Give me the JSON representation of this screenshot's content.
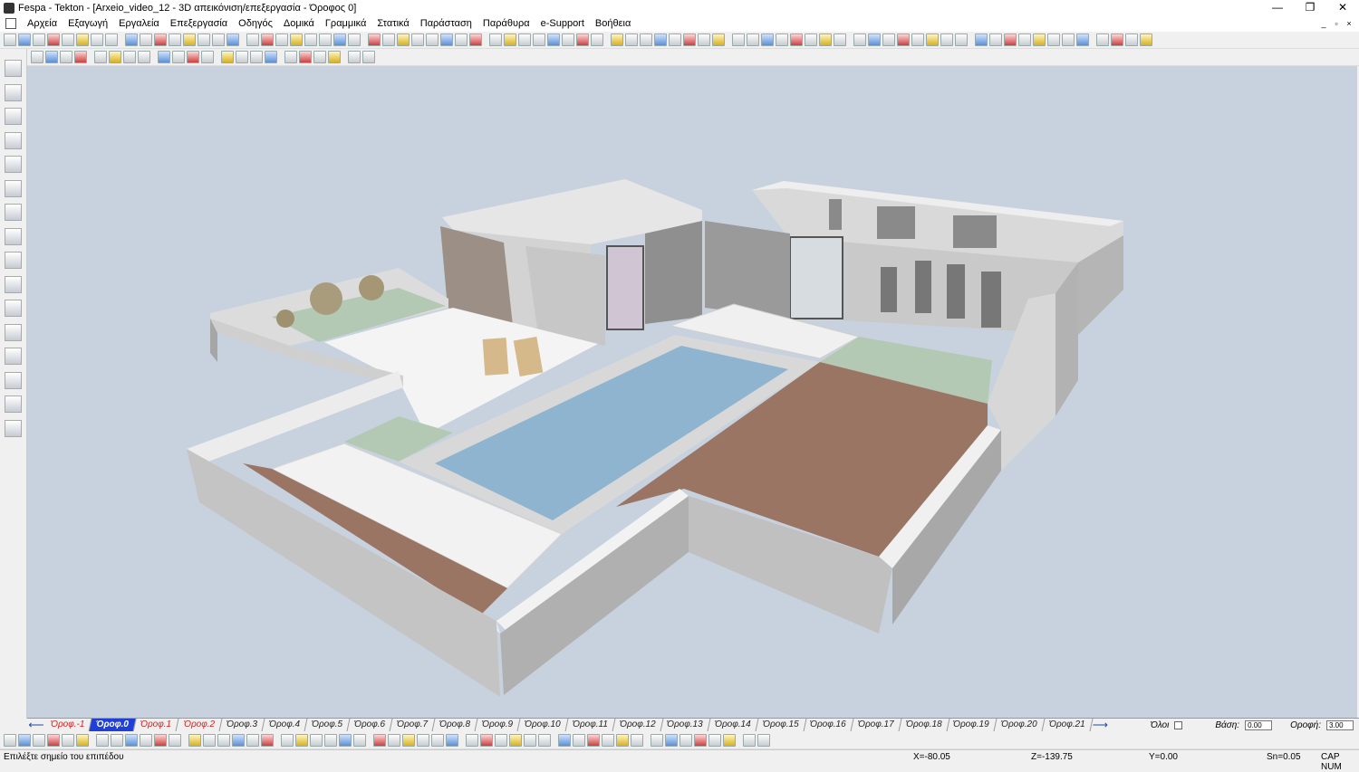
{
  "window": {
    "title": "Fespa - Tekton - [Arxeio_video_12 - 3D απεικόνιση/επεξεργασία - Όροφος 0]",
    "minimize_glyph": "—",
    "restore_glyph": "❐",
    "close_glyph": "✕"
  },
  "menu": [
    "Αρχεία",
    "Εξαγωγή",
    "Εργαλεία",
    "Επεξεργασία",
    "Οδηγός",
    "Δομικά",
    "Γραμμικά",
    "Στατικά",
    "Παράσταση",
    "Παράθυρα",
    "e-Support",
    "Βοήθεια"
  ],
  "mdi_buttons": [
    "_",
    "▫",
    "×"
  ],
  "floors": {
    "left_arrow": "⟵",
    "right_arrow": "⟶",
    "tabs": [
      {
        "label": "Όροφ.-1",
        "style": "red"
      },
      {
        "label": "Όροφ.0",
        "style": "active"
      },
      {
        "label": "Όροφ.1",
        "style": "red"
      },
      {
        "label": "Όροφ.2",
        "style": "red"
      },
      {
        "label": "Όροφ.3",
        "style": "normal"
      },
      {
        "label": "Όροφ.4",
        "style": "normal"
      },
      {
        "label": "Όροφ.5",
        "style": "normal"
      },
      {
        "label": "Όροφ.6",
        "style": "normal"
      },
      {
        "label": "Όροφ.7",
        "style": "normal"
      },
      {
        "label": "Όροφ.8",
        "style": "normal"
      },
      {
        "label": "Όροφ.9",
        "style": "normal"
      },
      {
        "label": "Όροφ.10",
        "style": "normal"
      },
      {
        "label": "Όροφ.11",
        "style": "normal"
      },
      {
        "label": "Όροφ.12",
        "style": "normal"
      },
      {
        "label": "Όροφ.13",
        "style": "normal"
      },
      {
        "label": "Όροφ.14",
        "style": "normal"
      },
      {
        "label": "Όροφ.15",
        "style": "normal"
      },
      {
        "label": "Όροφ.16",
        "style": "normal"
      },
      {
        "label": "Όροφ.17",
        "style": "normal"
      },
      {
        "label": "Όροφ.18",
        "style": "normal"
      },
      {
        "label": "Όροφ.19",
        "style": "normal"
      },
      {
        "label": "Όροφ.20",
        "style": "normal"
      },
      {
        "label": "Όροφ.21",
        "style": "normal"
      }
    ],
    "all_label": "Όλοι",
    "base_label": "Βάση:",
    "base_value": "0.00",
    "roof_label": "Οροφή:",
    "roof_value": "3.00"
  },
  "status": {
    "prompt": "Επιλέξτε σημείο του επιπέδου",
    "x": "X=-80.05",
    "z": "Z=-139.75",
    "y": "Y=0.00",
    "sn": "Sn=0.05",
    "caps": "CAP NUM"
  },
  "colors": {
    "viewport_bg": "#c7d2de",
    "wall_light": "#e8e8e8",
    "wall_mid": "#bdbdbd",
    "wall_dark": "#9c9c9c",
    "pool_water": "#8fb4cf",
    "deck": "#9a7564",
    "grass": "#b4c9b4",
    "active_floor": "#1f3fd6"
  }
}
